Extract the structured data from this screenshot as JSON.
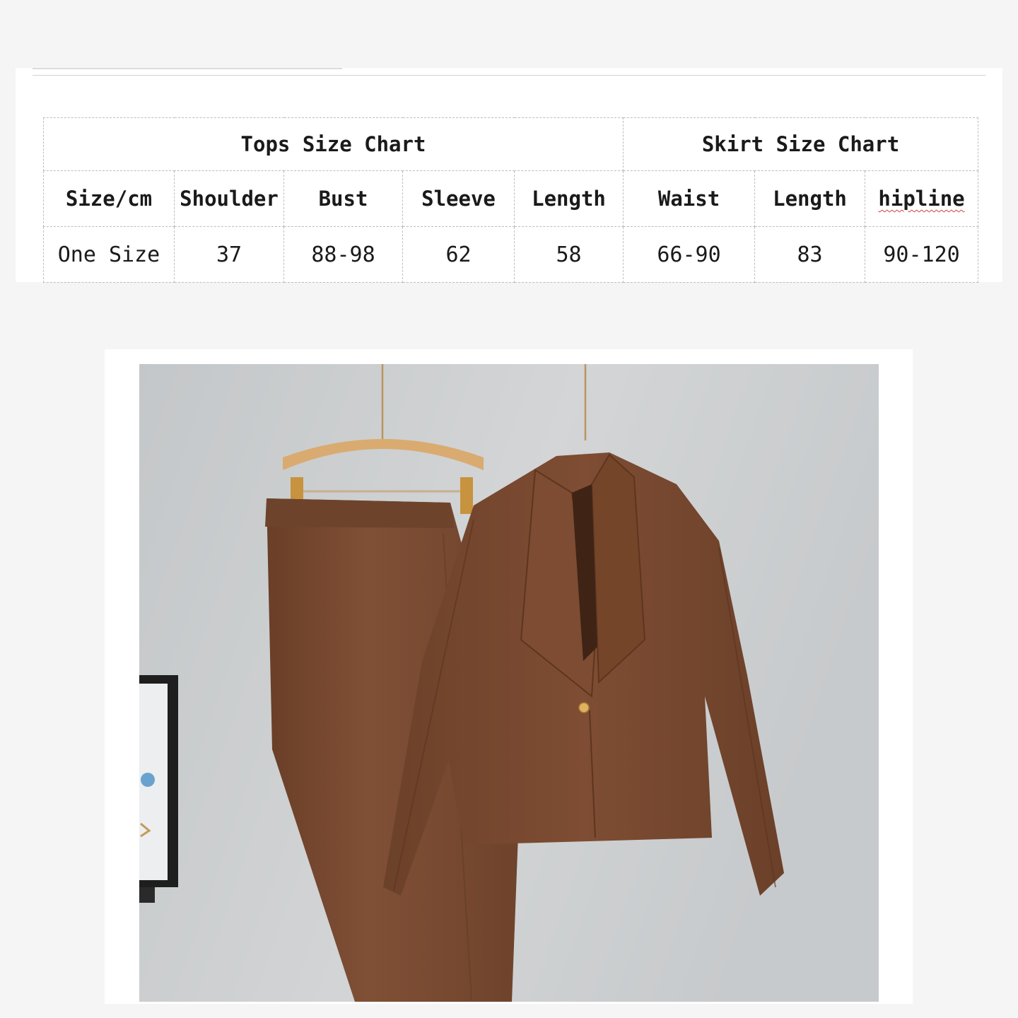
{
  "size_chart": {
    "tops_title": "Tops Size Chart",
    "skirt_title": "Skirt Size Chart",
    "headers": [
      "Size/cm",
      "Shoulder",
      "Bust",
      "Sleeve",
      "Length",
      "Waist",
      "Length",
      "hipline"
    ],
    "rows": [
      [
        "One Size",
        "37",
        "88-98",
        "62",
        "58",
        "66-90",
        "83",
        "90-120"
      ]
    ]
  },
  "photo": {
    "subject": "brown-knit-blazer-and-skirt-set-on-hangers",
    "colors": {
      "garment": "#7a4a30",
      "wall": "#cdd0d2",
      "hanger": "#d6a76c"
    }
  }
}
